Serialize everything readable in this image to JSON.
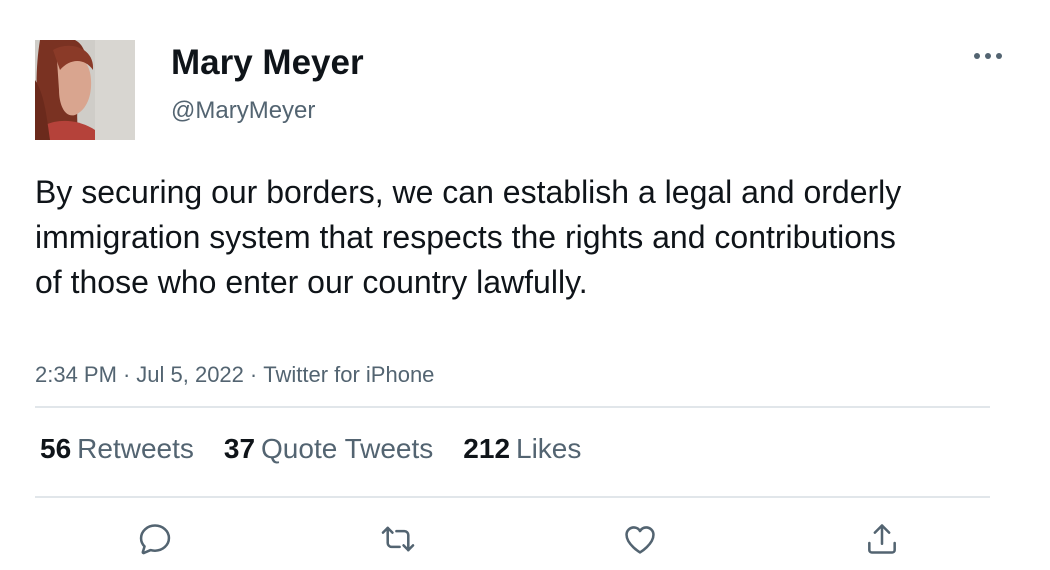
{
  "author": {
    "display_name": "Mary Meyer",
    "handle": "@MaryMeyer",
    "avatar_icon": "profile-photo"
  },
  "tweet": {
    "text": "By securing our borders, we can establish a legal and orderly immigration system that respects the rights and contributions of those who enter our country lawfully.",
    "time": "2:34 PM",
    "date": "Jul 5, 2022",
    "source": "Twitter for iPhone",
    "separator": "·"
  },
  "stats": {
    "retweets_count": "56",
    "retweets_label": "Retweets",
    "quotes_count": "37",
    "quotes_label": "Quote Tweets",
    "likes_count": "212",
    "likes_label": "Likes"
  },
  "actions": {
    "reply_icon": "reply-icon",
    "retweet_icon": "retweet-icon",
    "like_icon": "heart-icon",
    "share_icon": "share-icon",
    "more_icon": "more-icon"
  },
  "colors": {
    "text_primary": "#0f1419",
    "text_secondary": "#536471",
    "divider": "#e1e6ea",
    "icon": "#536471"
  }
}
